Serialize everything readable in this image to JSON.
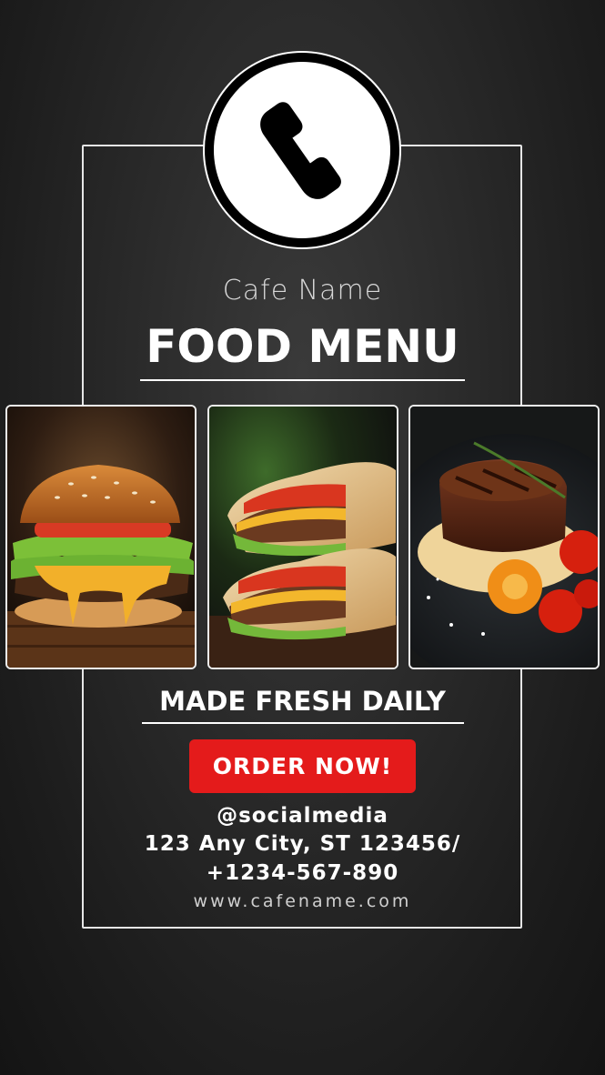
{
  "header": {
    "icon": "phone-icon",
    "cafe_name": "Cafe Name",
    "title": "FOOD MENU"
  },
  "photos": [
    {
      "name": "burger-photo"
    },
    {
      "name": "wrap-photo"
    },
    {
      "name": "steak-photo"
    }
  ],
  "tagline": "MADE FRESH DAILY",
  "cta": {
    "label": "ORDER NOW!",
    "color": "#e41b1b"
  },
  "contact": {
    "social": "@socialmedia",
    "address": "123 Any City, ST 123456/",
    "phone": "+1234-567-890",
    "website": "www.cafename.com"
  },
  "colors": {
    "background": "#222222",
    "text": "#ffffff",
    "accent": "#e41b1b"
  }
}
